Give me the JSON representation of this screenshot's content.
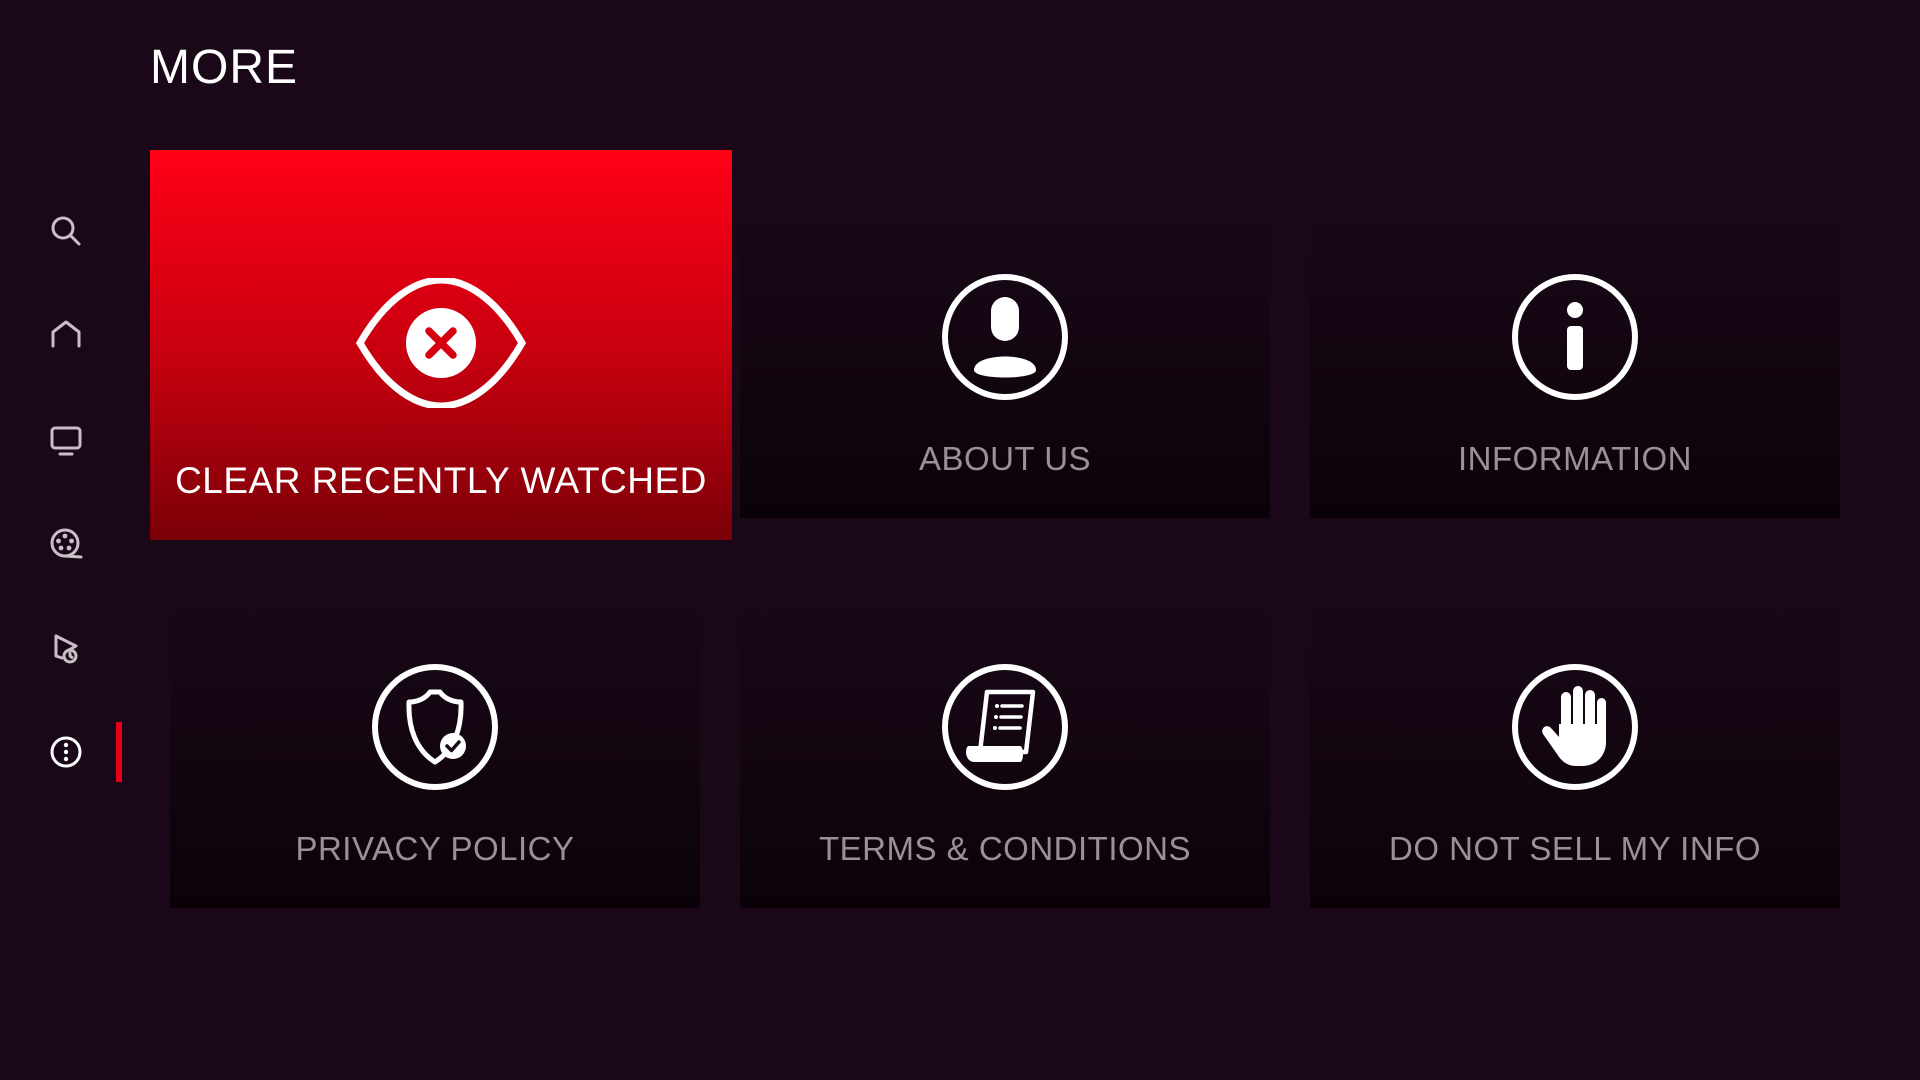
{
  "page": {
    "title": "MORE"
  },
  "sidebar": {
    "items": [
      {
        "icon": "search-icon"
      },
      {
        "icon": "home-icon"
      },
      {
        "icon": "tv-icon"
      },
      {
        "icon": "film-reel-icon"
      },
      {
        "icon": "watch-history-icon"
      },
      {
        "icon": "more-icon",
        "active": true
      }
    ]
  },
  "tiles": [
    {
      "label": "CLEAR RECENTLY WATCHED",
      "icon": "eye-cross-icon",
      "focused": true
    },
    {
      "label": "ABOUT US",
      "icon": "user-icon"
    },
    {
      "label": "INFORMATION",
      "icon": "info-icon"
    },
    {
      "label": "PRIVACY POLICY",
      "icon": "shield-check-icon"
    },
    {
      "label": "TERMS & CONDITIONS",
      "icon": "document-scroll-icon"
    },
    {
      "label": "DO NOT SELL MY INFO",
      "icon": "hand-stop-icon"
    }
  ],
  "colors": {
    "background": "#1a0818",
    "accent": "#e2001a",
    "label": "#9a9098",
    "icon": "#ffffff"
  }
}
